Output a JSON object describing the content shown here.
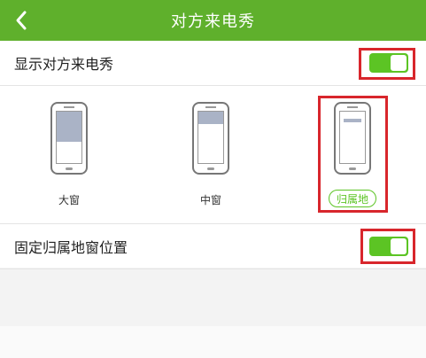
{
  "header": {
    "title": "对方来电秀",
    "back_icon": "chevron-left-icon"
  },
  "settings": {
    "show_caller_show": {
      "label": "显示对方来电秀",
      "enabled": true
    },
    "fixed_location_window": {
      "label": "固定归属地窗位置",
      "enabled": true
    }
  },
  "window_options": [
    {
      "label": "大窗",
      "selected": false
    },
    {
      "label": "中窗",
      "selected": false
    },
    {
      "label": "归属地",
      "selected": true
    }
  ],
  "colors": {
    "brand_green": "#5fb02c",
    "toggle_green": "#5cc424",
    "highlight_red": "#d8262c"
  }
}
